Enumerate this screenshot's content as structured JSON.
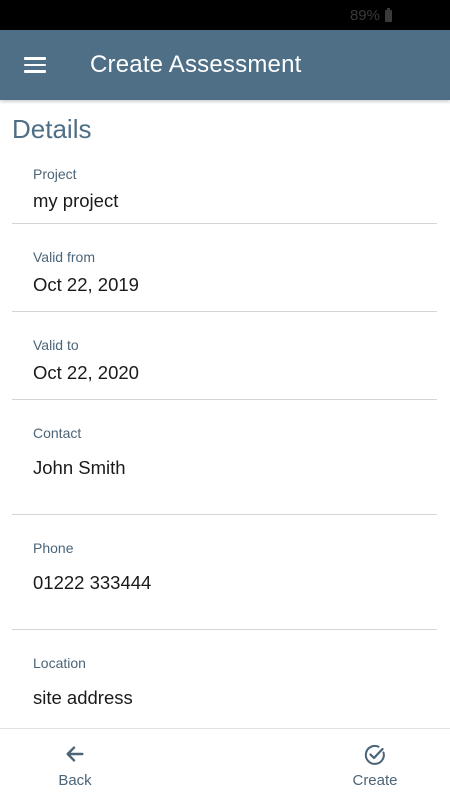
{
  "status_bar": {
    "battery": "89%"
  },
  "app_bar": {
    "title": "Create Assessment",
    "menu_icon": "hamburger-menu-icon"
  },
  "section": {
    "heading": "Details"
  },
  "fields": [
    {
      "label": "Project",
      "value": "my project"
    },
    {
      "label": "Valid from",
      "value": "Oct 22, 2019"
    },
    {
      "label": "Valid to",
      "value": "Oct 22, 2020"
    },
    {
      "label": "Contact",
      "value": "John Smith"
    },
    {
      "label": "Phone",
      "value": "01222 333444"
    },
    {
      "label": "Location",
      "value": "site address"
    }
  ],
  "bottom_nav": {
    "back": {
      "label": "Back",
      "icon": "arrow-left-icon"
    },
    "create": {
      "label": "Create",
      "icon": "check-circle-icon"
    }
  },
  "colors": {
    "primary": "#4e6f86",
    "label": "#4b6477",
    "divider": "#d5d5d5"
  }
}
